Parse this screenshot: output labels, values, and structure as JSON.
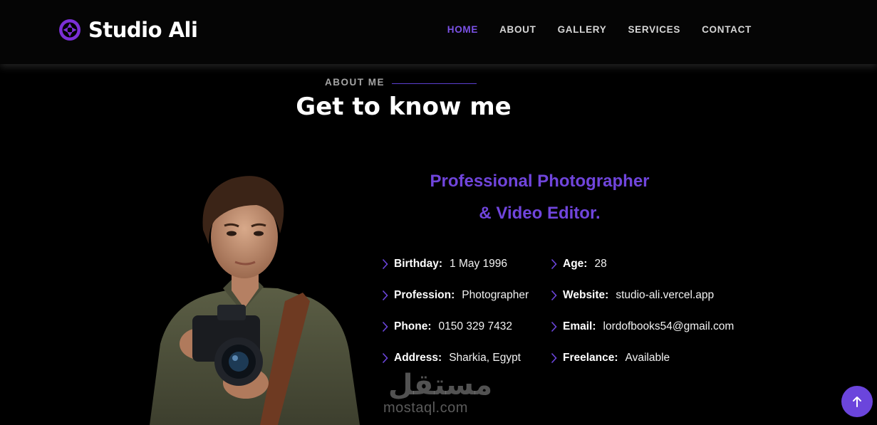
{
  "brand": {
    "name": "Studio Ali",
    "logo_icon": "aperture-icon",
    "accent": "#7b52e6"
  },
  "nav": {
    "items": [
      {
        "label": "HOME",
        "active": true
      },
      {
        "label": "ABOUT",
        "active": false
      },
      {
        "label": "GALLERY",
        "active": false
      },
      {
        "label": "SERVICES",
        "active": false
      },
      {
        "label": "CONTACT",
        "active": false
      }
    ]
  },
  "about": {
    "eyebrow": "ABOUT ME",
    "title": "Get to know me",
    "headline_line1": "Professional Photographer",
    "headline_line2": "& Video Editor.",
    "details": [
      {
        "label": "Birthday:",
        "value": "1 May 1996"
      },
      {
        "label": "Age:",
        "value": "28"
      },
      {
        "label": "Profession:",
        "value": "Photographer"
      },
      {
        "label": "Website:",
        "value": "studio-ali.vercel.app"
      },
      {
        "label": "Phone:",
        "value": "0150 329 7432"
      },
      {
        "label": "Email:",
        "value": "lordofbooks54@gmail.com"
      },
      {
        "label": "Address:",
        "value": "Sharkia, Egypt"
      },
      {
        "label": "Freelance:",
        "value": "Available"
      }
    ]
  },
  "watermark": {
    "arabic": "مستقل",
    "latin": "mostaql.com"
  },
  "scroll_top": {
    "icon": "arrow-up-icon",
    "color": "#6b45dc"
  }
}
